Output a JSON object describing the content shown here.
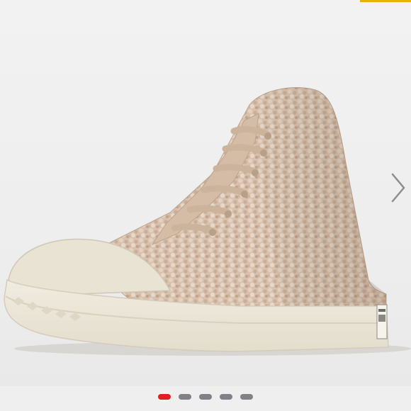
{
  "image": {
    "alt": "",
    "colors": {
      "background": "#efefef",
      "upper": "#d7c0ad",
      "sole": "#ebe6d7",
      "laces": "#cdb7a2",
      "accent": "#e6b400"
    }
  },
  "navigation": {
    "next_icon": "chevron-right-icon"
  },
  "carousel": {
    "total": 5,
    "active_index": 0,
    "colors": {
      "active": "#e21c25",
      "inactive": "#7f8187"
    }
  }
}
